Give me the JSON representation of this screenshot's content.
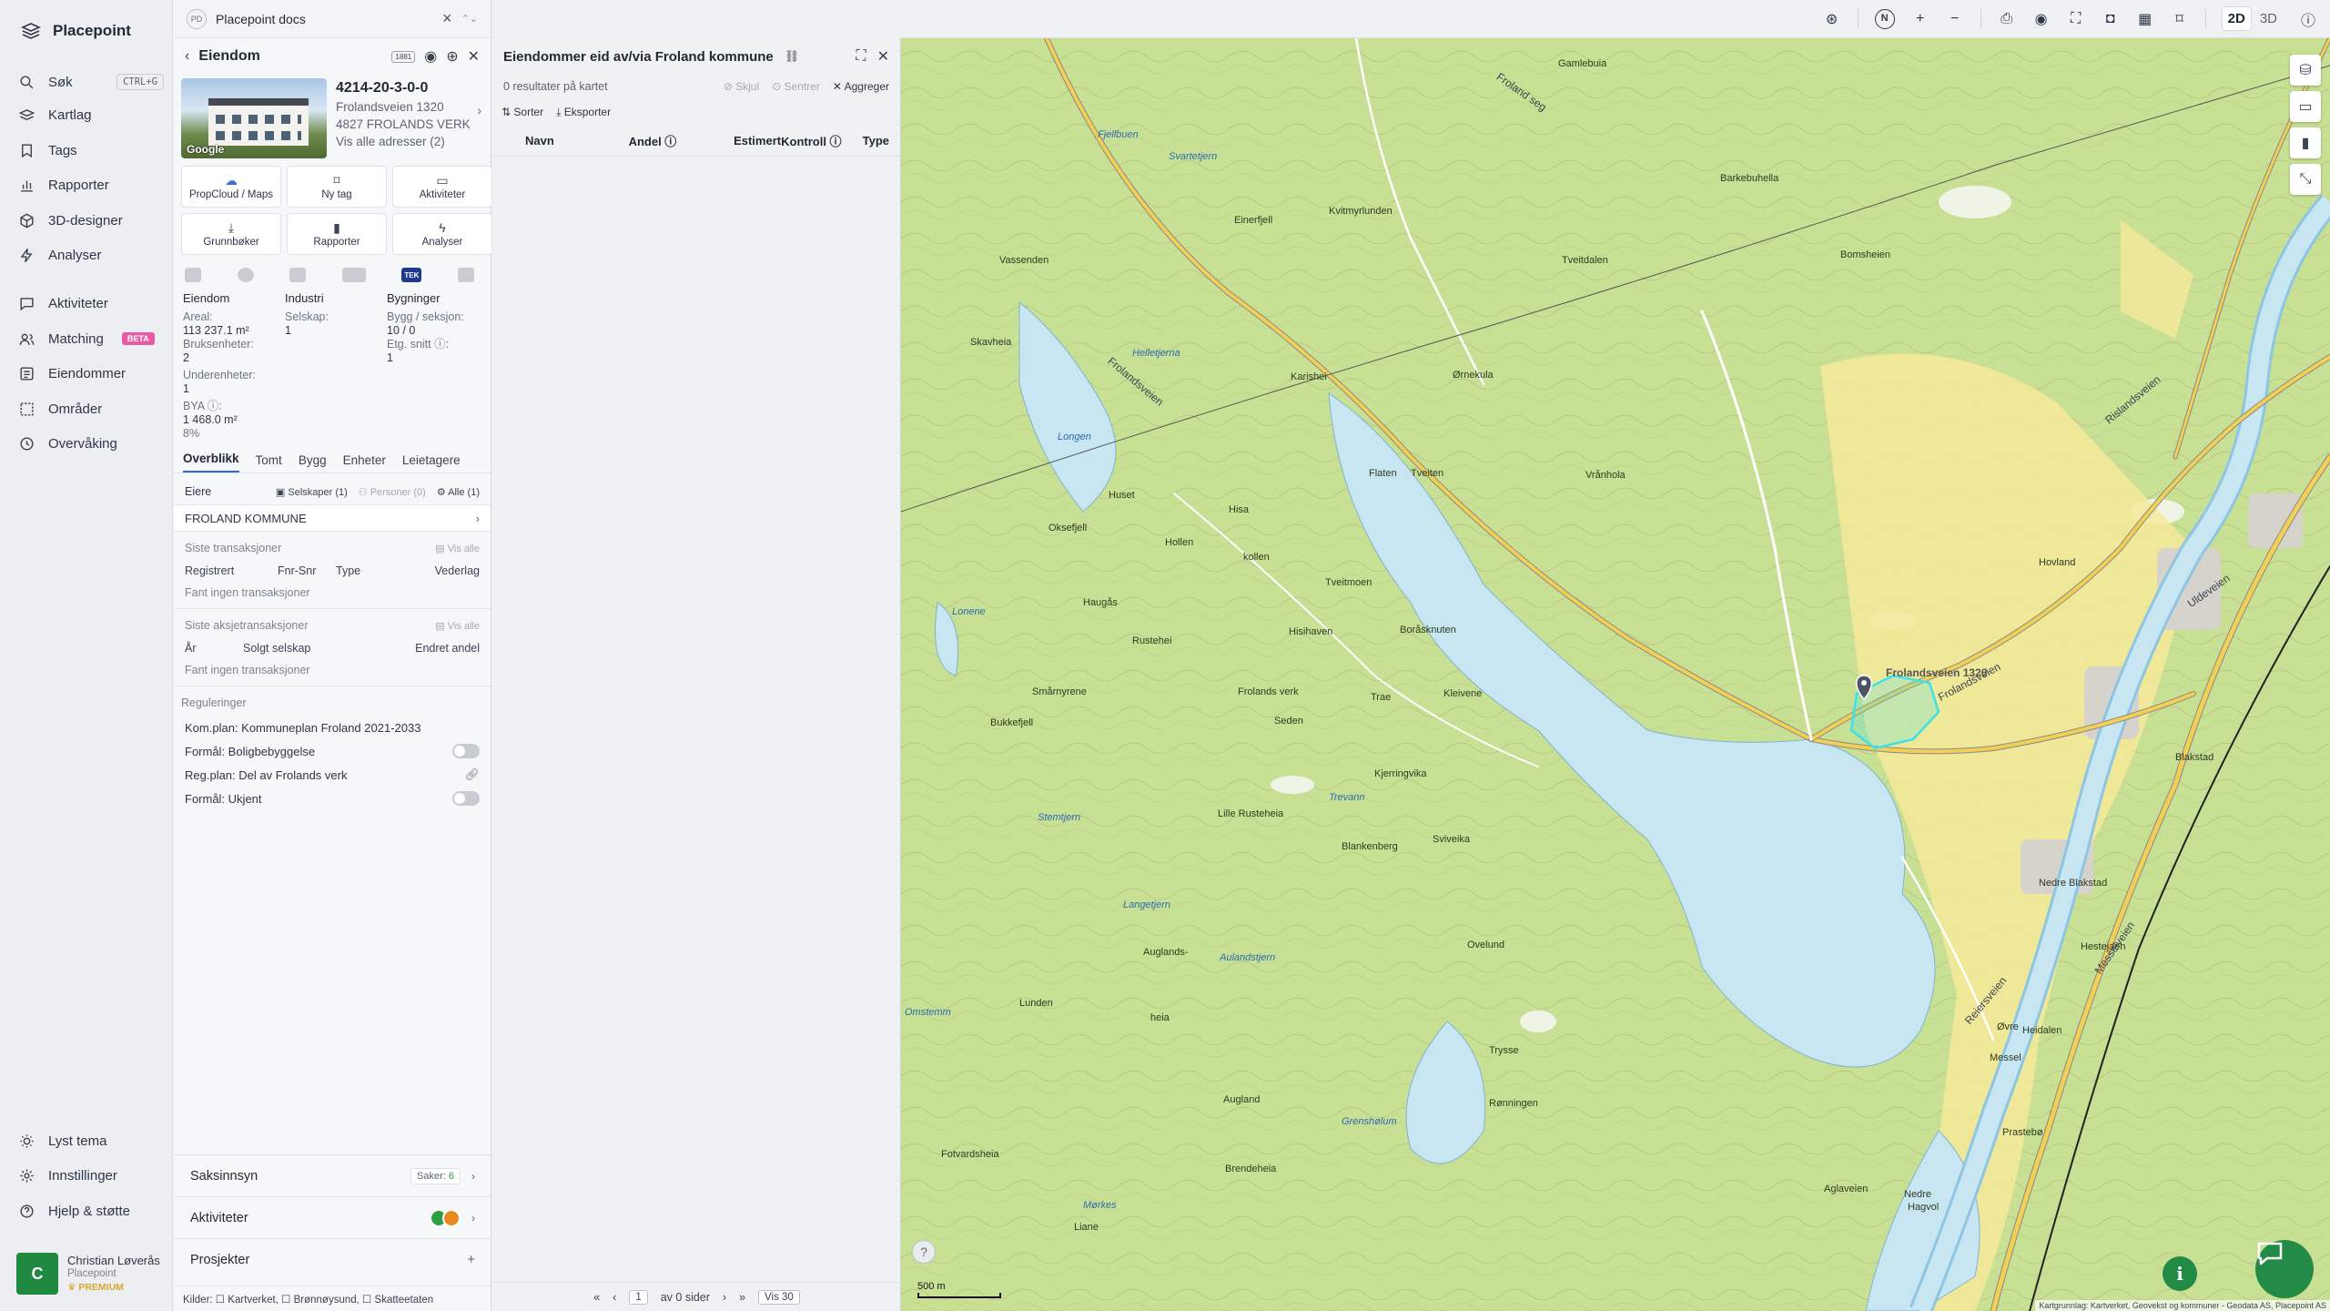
{
  "nav": {
    "brand": "Placepoint",
    "items": [
      {
        "label": "Søk",
        "icon": "search-icon",
        "kbd": "CTRL+G"
      },
      {
        "label": "Kartlag",
        "icon": "layers-icon"
      },
      {
        "label": "Tags",
        "icon": "bookmark-icon"
      },
      {
        "label": "Rapporter",
        "icon": "bar-chart-icon"
      },
      {
        "label": "3D-designer",
        "icon": "cube-icon"
      },
      {
        "label": "Analyser",
        "icon": "bolt-icon"
      },
      {
        "label": "Aktiviteter",
        "icon": "chat-icon"
      },
      {
        "label": "Matching",
        "icon": "users-icon",
        "badge": "BETA"
      },
      {
        "label": "Eiendommer",
        "icon": "list-icon"
      },
      {
        "label": "Områder",
        "icon": "area-icon"
      },
      {
        "label": "Overvåking",
        "icon": "monitor-icon"
      }
    ],
    "bottom": [
      {
        "label": "Lyst tema",
        "icon": "sun-icon"
      },
      {
        "label": "Innstillinger",
        "icon": "gear-icon"
      },
      {
        "label": "Hjelp & støtte",
        "icon": "help-icon"
      }
    ],
    "user": {
      "initial": "C",
      "name": "Christian Løverås",
      "org": "Placepoint",
      "plan": "PREMIUM"
    }
  },
  "docs": {
    "badge": "PD",
    "title": "Placepoint docs"
  },
  "property": {
    "header": "Eiendom",
    "photo_label": "Google",
    "id": "4214-20-3-0-0",
    "street": "Frolandsveien 1320",
    "city": "4827 FROLANDS VERK",
    "all_addresses": "Vis alle adresser (2)",
    "actions": [
      {
        "label": "PropCloud / Maps",
        "icon": "cloud-icon"
      },
      {
        "label": "Ny tag",
        "icon": "bookmark-icon"
      },
      {
        "label": "Aktiviteter",
        "icon": "chat-icon"
      },
      {
        "label": "Grunnbøker",
        "icon": "download-icon"
      },
      {
        "label": "Rapporter",
        "icon": "bar-chart-icon"
      },
      {
        "label": "Analyser",
        "icon": "bolt-icon"
      }
    ],
    "tek_logo": "TEK",
    "stats": {
      "eiendom": {
        "title": "Eiendom",
        "areal_label": "Areal:",
        "areal": "113 237.1 m²",
        "bruks_label": "Bruksenheter:",
        "bruks": "2",
        "under_label": "Underenheter:",
        "under": "1",
        "bya_label": "BYA ⓘ:",
        "bya": "1 468.0 m²",
        "bya_pct": "8%"
      },
      "industri": {
        "title": "Industri",
        "selskap_label": "Selskap:",
        "selskap": "1"
      },
      "bygninger": {
        "title": "Bygninger",
        "bygg_label": "Bygg / seksjon:",
        "bygg": "10 / 0",
        "etg_label": "Etg. snitt ⓘ:",
        "etg": "1"
      }
    },
    "tabs": [
      "Overblikk",
      "Tomt",
      "Bygg",
      "Enheter",
      "Leietagere"
    ],
    "owners": {
      "label": "Eiere",
      "chip1": "Selskaper (1)",
      "chip2": "Personer (0)",
      "chip3": "Alle (1)",
      "owner": "FROLAND KOMMUNE"
    },
    "transactions": {
      "label": "Siste transaksjoner",
      "show_all": "Vis alle",
      "cols": [
        "Registrert",
        "Fnr-Snr",
        "Type",
        "Vederlag"
      ],
      "empty": "Fant ingen transaksjoner"
    },
    "share_transactions": {
      "label": "Siste aksjetransaksjoner",
      "show_all": "Vis alle",
      "cols": [
        "År",
        "Solgt selskap",
        "Endret andel"
      ],
      "empty": "Fant ingen transaksjoner"
    },
    "regulations": {
      "label": "Reguleringer",
      "items": [
        "Kom.plan: Kommuneplan Froland 2021-2033",
        "Formål: Boligbebyggelse",
        "Reg.plan: Del av Frolands verk",
        "Formål: Ukjent"
      ]
    },
    "saksinnsyn": {
      "label": "Saksinnsyn",
      "badge_label": "Saker:",
      "badge_count": "6"
    },
    "aktiviteter_label": "Aktiviteter",
    "prosjekter_label": "Prosjekter",
    "sources": "Kilder: ☐ Kartverket, ☐ Brønnøysund, ☐ Skatteetaten"
  },
  "results": {
    "title": "Eiendommer eid av/via Froland kommune",
    "count": "0 resultater på kartet",
    "skjul": "Skjul",
    "sentrer": "Sentrer",
    "aggreger": "Aggreger",
    "sorter": "Sorter",
    "eksporter": "Eksporter",
    "columns": [
      "Navn",
      "Andel ⓘ",
      "Estimert",
      "Kontroll ⓘ",
      "Type"
    ],
    "pager": {
      "page": "1",
      "of": "av 0 sider",
      "per_page": "Vis 30"
    }
  },
  "topbar": {
    "north": "N",
    "mode_2d": "2D",
    "mode_3d": "3D"
  },
  "map": {
    "scale": "500 m",
    "attribution": "Kartgrunnlag: Kartverket, Geovekst og kommuner - Geodata AS, Placepoint AS",
    "marker_label": "Frolandsveien 1320",
    "places": [
      "Gamlebuia",
      "Barkebuhella",
      "Kvitmyrlunden",
      "Einerfjell",
      "Tveitdalen",
      "Bomsheien",
      "Vassenden",
      "Skavheia",
      "Karishei",
      "Ørnekula",
      "Flaten",
      "Tveiten",
      "Vrånhola",
      "Oksefjell",
      "Hollen",
      "Huset",
      "Hisa",
      "kollen",
      "Tveitmoen",
      "Haugås",
      "Rustehei",
      "Hisihaven",
      "Boråsknuten",
      "Smårnyrene",
      "Frolands verk",
      "Seden",
      "Trae",
      "Kleivene",
      "Kjerringvika",
      "Bukkefjell",
      "Lille Rusteheia",
      "Blankenberg",
      "Sviveika",
      "Auglands-",
      "heia",
      "Lunden",
      "Augland",
      "Nedre Blakstad",
      "Hestejaen",
      "Brendeheia",
      "Fotvardsheia",
      "Liane",
      "Ovelund",
      "Heidalen",
      "Messel",
      "Nedre",
      "Hagvol",
      "Trysse",
      "Rønningen",
      "Øvre",
      "Aglaveien",
      "Prastebø",
      "Blakstad",
      "Hovland"
    ],
    "waters": [
      "Fjellbuen",
      "Svartetjern",
      "Helletjerna",
      "Longen",
      "Lonene",
      "Trevann",
      "Aulandstjern",
      "Langetjern",
      "Stemtjern",
      "Grenshølum",
      "Omstemm",
      "Mørkes"
    ],
    "roads": [
      "Frolandsveien",
      "Frolandsveien",
      "Rislandsveien",
      "Froland seg",
      "Messelveien",
      "Reiersveien",
      "Uldeveien"
    ]
  },
  "colors": {
    "accent": "#3266d1",
    "brand_green": "#228b46",
    "map_land": "#c5df8f",
    "map_water": "#c8e6f2",
    "map_road": "#f2cf55",
    "selection": "#3de0ea"
  }
}
